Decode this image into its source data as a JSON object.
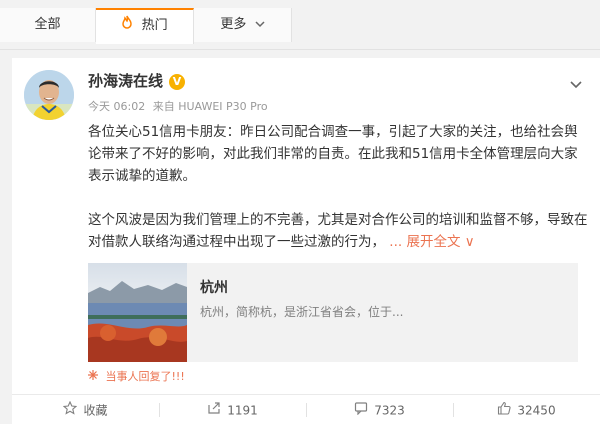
{
  "tabs": [
    {
      "label": "全部"
    },
    {
      "label": "热门"
    },
    {
      "label": "更多"
    }
  ],
  "post": {
    "author": "孙海涛在线",
    "verified_badge": "V",
    "time": "今天 06:02",
    "source": "来自 HUAWEI P30 Pro",
    "paragraph1": "各位关心51信用卡朋友：昨日公司配合调查一事，引起了大家的关注，也给社会舆论带来了不好的影响，对此我们非常的自责。在此我和51信用卡全体管理层向大家表示诚挚的道歉。",
    "paragraph2": "这个风波是因为我们管理上的不完善，尤其是对合作公司的培训和监督不够，导致在对借款人联络沟通过程中出现了一些过激的行为，",
    "expand_label": "... 展开全文 ∨",
    "link_card": {
      "title": "杭州",
      "description": "杭州，简称杭，是浙江省省会，位于..."
    },
    "reply_note": "当事人回复了!!!"
  },
  "actions": {
    "favorite": "收藏",
    "repost": "1191",
    "comment": "7323",
    "like": "32450"
  },
  "colors": {
    "accent": "#ff8200",
    "link": "#eb7350",
    "verified": "#f8b100"
  }
}
